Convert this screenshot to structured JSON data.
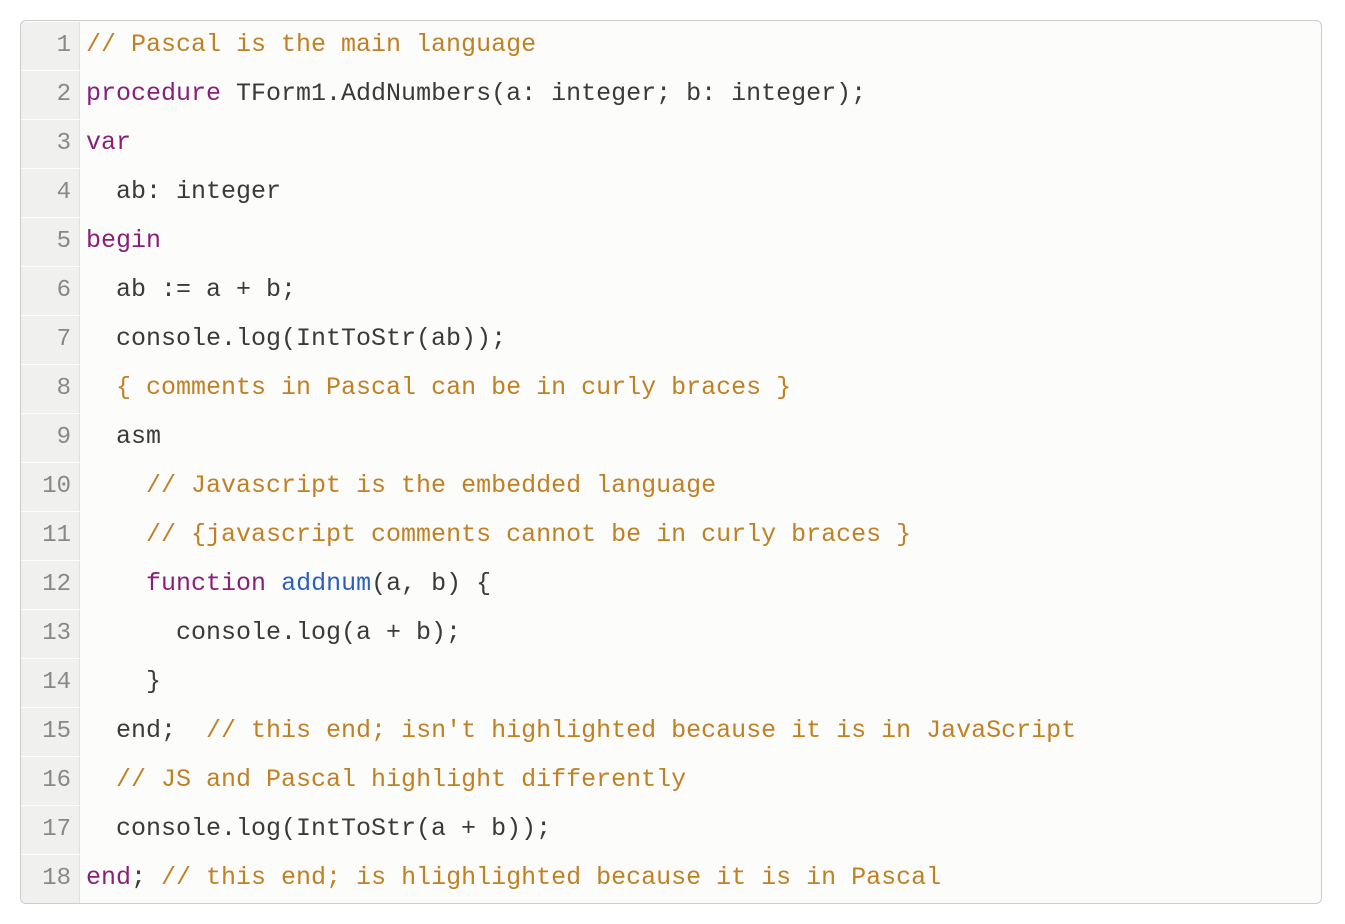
{
  "colors": {
    "comment": "#c08024",
    "keyword": "#8a1f7a",
    "default": "#3a3a3a",
    "func": "#2a5fbf",
    "border": "#cccccc",
    "gutter_bg": "#f0f0ef",
    "gutter_fg": "#888888"
  },
  "lines": [
    {
      "n": "1",
      "tokens": [
        {
          "cls": "comment",
          "t": "// Pascal is the main language"
        }
      ]
    },
    {
      "n": "2",
      "tokens": [
        {
          "cls": "keyword",
          "t": "procedure"
        },
        {
          "cls": "default",
          "t": " TForm1.AddNumbers(a: integer; b: integer);"
        }
      ]
    },
    {
      "n": "3",
      "tokens": [
        {
          "cls": "keyword",
          "t": "var"
        }
      ]
    },
    {
      "n": "4",
      "tokens": [
        {
          "cls": "default",
          "t": "  ab: integer"
        }
      ]
    },
    {
      "n": "5",
      "tokens": [
        {
          "cls": "keyword",
          "t": "begin"
        }
      ]
    },
    {
      "n": "6",
      "tokens": [
        {
          "cls": "default",
          "t": "  ab := a + b;"
        }
      ]
    },
    {
      "n": "7",
      "tokens": [
        {
          "cls": "default",
          "t": "  console.log(IntToStr(ab));"
        }
      ]
    },
    {
      "n": "8",
      "tokens": [
        {
          "cls": "default",
          "t": "  "
        },
        {
          "cls": "comment",
          "t": "{ comments in Pascal can be in curly braces }"
        }
      ]
    },
    {
      "n": "9",
      "tokens": [
        {
          "cls": "default",
          "t": "  asm"
        }
      ]
    },
    {
      "n": "10",
      "tokens": [
        {
          "cls": "default",
          "t": "    "
        },
        {
          "cls": "comment",
          "t": "// Javascript is the embedded language"
        }
      ]
    },
    {
      "n": "11",
      "tokens": [
        {
          "cls": "default",
          "t": "    "
        },
        {
          "cls": "comment",
          "t": "// {javascript comments cannot be in curly braces }"
        }
      ]
    },
    {
      "n": "12",
      "tokens": [
        {
          "cls": "default",
          "t": "    "
        },
        {
          "cls": "keyword",
          "t": "function"
        },
        {
          "cls": "default",
          "t": " "
        },
        {
          "cls": "func",
          "t": "addnum"
        },
        {
          "cls": "default",
          "t": "(a, b) {"
        }
      ]
    },
    {
      "n": "13",
      "tokens": [
        {
          "cls": "default",
          "t": "      console.log(a + b);"
        }
      ]
    },
    {
      "n": "14",
      "tokens": [
        {
          "cls": "default",
          "t": "    }"
        }
      ]
    },
    {
      "n": "15",
      "tokens": [
        {
          "cls": "default",
          "t": "  end;  "
        },
        {
          "cls": "comment",
          "t": "// this end; isn't highlighted because it is in JavaScript"
        }
      ]
    },
    {
      "n": "16",
      "tokens": [
        {
          "cls": "default",
          "t": "  "
        },
        {
          "cls": "comment",
          "t": "// JS and Pascal highlight differently"
        }
      ]
    },
    {
      "n": "17",
      "tokens": [
        {
          "cls": "default",
          "t": "  console.log(IntToStr(a + b));"
        }
      ]
    },
    {
      "n": "18",
      "tokens": [
        {
          "cls": "keyword",
          "t": "end"
        },
        {
          "cls": "default",
          "t": "; "
        },
        {
          "cls": "comment",
          "t": "// this end; is hlighlighted because it is in Pascal"
        }
      ]
    }
  ]
}
